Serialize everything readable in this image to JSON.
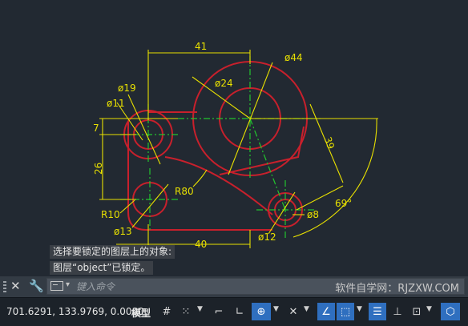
{
  "drawing": {
    "dimensions": {
      "width_top": "41",
      "dia_44": "ø44",
      "dia_24": "ø24",
      "dia_19": "ø19",
      "dia_11": "ø11",
      "height_7": "7",
      "height_26": "26",
      "slant_39": "39",
      "radius_80": "R80",
      "radius_10": "R10",
      "dia_13": "ø13",
      "width_bottom": "40",
      "dia_12": "ø12",
      "dia_8": "ø8",
      "angle_69": "69°"
    },
    "colors": {
      "background": "#222932",
      "object": "#c8202c",
      "dimension": "#e8e000",
      "centerline": "#22c52e",
      "hidden": "#c8d0d8"
    }
  },
  "command_history": [
    "选择要锁定的图层上的对象:",
    "图层“object”已锁定。"
  ],
  "command_line": {
    "placeholder": "键入命令",
    "watermark": "软件自学网：RJZXW.COM"
  },
  "status_bar": {
    "coordinates": "701.6291, 133.9769, 0.0000",
    "model_label": "模型",
    "tools": [
      "grid-icon",
      "snap-icon",
      "ortho-icon",
      "polar-icon",
      "osnap-icon",
      "otrack-icon",
      "lineweight-icon",
      "transparency-icon",
      "selection-cycle-icon",
      "annotation-icon",
      "workspace-icon"
    ]
  }
}
